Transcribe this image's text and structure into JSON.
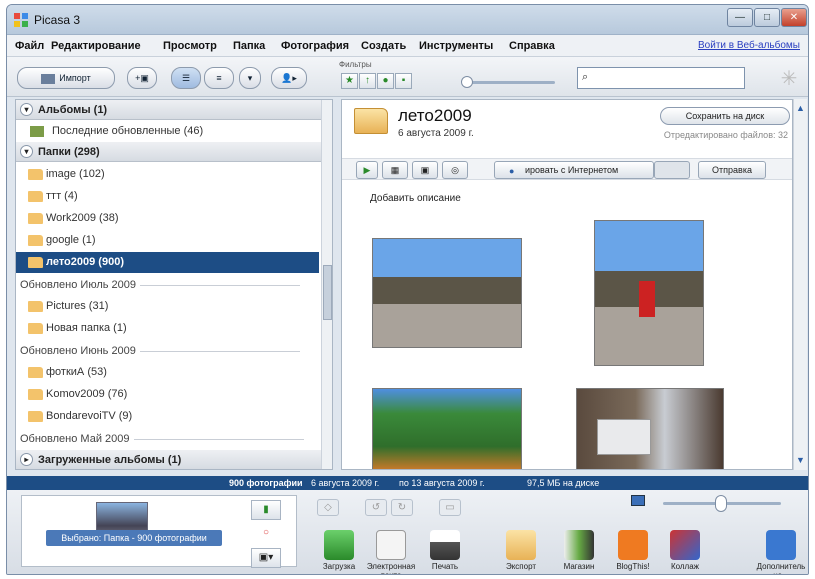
{
  "window": {
    "title": "Picasa 3",
    "min_label": "—",
    "max_label": "□",
    "close_label": "✕"
  },
  "menu": {
    "items": [
      "Файл",
      "Редактирование",
      "Просмотр",
      "Папка",
      "Фотография",
      "Создать",
      "Инструменты",
      "Справка"
    ],
    "login": "Войти в Веб-альбомы"
  },
  "toolbar": {
    "import_label": "Импорт",
    "filters_label": "Фильтры",
    "search_value": ""
  },
  "left_panel": {
    "albums_header": "Альбомы (1)",
    "albums": [
      {
        "label": "Последние обновленные (46)"
      }
    ],
    "folders_header": "Папки (298)",
    "folders_top": [
      {
        "label": "image (102)"
      },
      {
        "label": "ттт (4)"
      },
      {
        "label": "Work2009 (38)"
      },
      {
        "label": "google (1)"
      },
      {
        "label": "лето2009 (900)"
      }
    ],
    "group_july": "Обновлено Июль 2009",
    "folders_july": [
      {
        "label": "Pictures (31)"
      },
      {
        "label": "Новая папка (1)"
      }
    ],
    "group_june": "Обновлено Июнь 2009",
    "folders_june": [
      {
        "label": "фоткиА (53)"
      },
      {
        "label": "Komov2009 (76)"
      },
      {
        "label": "BondarevoiTV (9)"
      }
    ],
    "group_may": "Обновлено Май 2009",
    "uploaded_header": "Загруженные альбомы (1)"
  },
  "album": {
    "title": "лето2009",
    "date": "6 августа 2009 г.",
    "save_button": "Сохранить на диск",
    "edited_text": "Отредактировано файлов: 32",
    "sync_label": "ировать с Интернетом",
    "send_button": "Отправка",
    "description_placeholder": "Добавить описание"
  },
  "status": {
    "count": "900 фотографии",
    "from": "6 августа 2009 г.",
    "to": "по 13 августа 2009 г.",
    "size": "97,5 МБ на диске"
  },
  "bottom": {
    "selection_label": "Выбрано: Папка - 900 фотографии",
    "actions": [
      "Загрузка",
      "Электронная почта",
      "Печать",
      "Экспорт",
      "Магазин",
      "BlogThis!",
      "Коллаж",
      "Дополнитель но..."
    ]
  },
  "colors": {
    "selection": "#1d4d85",
    "statusbar": "#1d4d85",
    "folder": "#f3c36b"
  }
}
